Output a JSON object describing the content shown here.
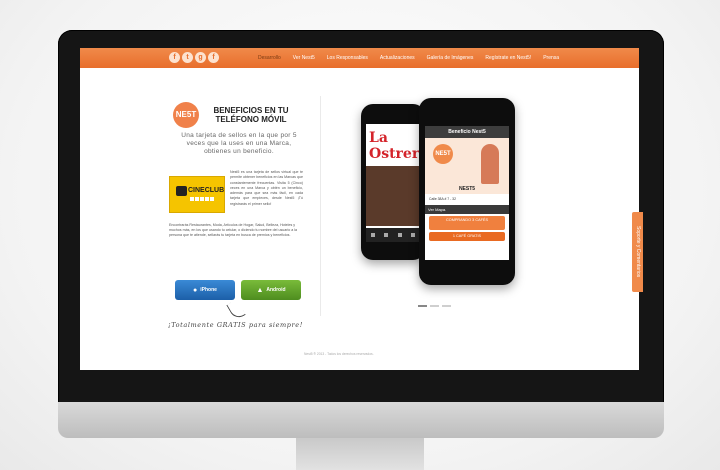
{
  "nav": {
    "social": [
      "f",
      "t",
      "g",
      "f"
    ],
    "items": [
      {
        "label": "Desarrollo",
        "active": true
      },
      {
        "label": "Ver Nest5",
        "active": false
      },
      {
        "label": "Los Responsables",
        "active": false
      },
      {
        "label": "Actualizaciones",
        "active": false
      },
      {
        "label": "Galería de Imágenes",
        "active": false
      },
      {
        "label": "Regístrate en Nest5!",
        "active": false
      },
      {
        "label": "Prensa",
        "active": false
      }
    ]
  },
  "left": {
    "logo_text": "NE5T",
    "headline": "BENEFICIOS EN TU TELÉFONO MÓVIL",
    "lead": "Una tarjeta de sellos en la que por 5 veces que la uses en una Marca, obtienes un beneficio.",
    "cineclub": "CINECLUB",
    "desc": "Nest5 es una tarjeta de sellos virtual que te permite obtener beneficios en las Marcas que constantemente frecuentas. Visita 5 (Cinco) veces en una Marca y obtén un beneficio, además para que sea más fácil, en cada tarjeta que empieces, desde Nest5 ¡Tú registrarás el primer sello!",
    "desc2": "Encontrarás Restaurantes, Moda, Artículos de Hogar, Salud, Belleza, Hoteles y muchos más, en los que usando tu celular, o diciendo tu nombre del usuario a la persona que te atiende, sellarás tu tarjeta en busca de premios y beneficios.",
    "ios_button": "iPhone",
    "android_button": "Android",
    "gratis": "¡Totalmente GRATIS para siempre!"
  },
  "phones": {
    "back_brand": "La Ostrería",
    "front_title": "Beneficio Nest5",
    "front_logo": "NE5T",
    "front_name": "NEST5",
    "front_address": "Calle 38A # 7 - 32",
    "ver_mapa": "Ver Mapa.",
    "promo_line": "COMPRANDO 3 CAFÉS",
    "promo_sub": "1 CAFÉ GRATIS"
  },
  "footer": "Nest5 ® 2013 - Todos los derechos reservados.",
  "side_tab": "Soporte y Comentarios"
}
